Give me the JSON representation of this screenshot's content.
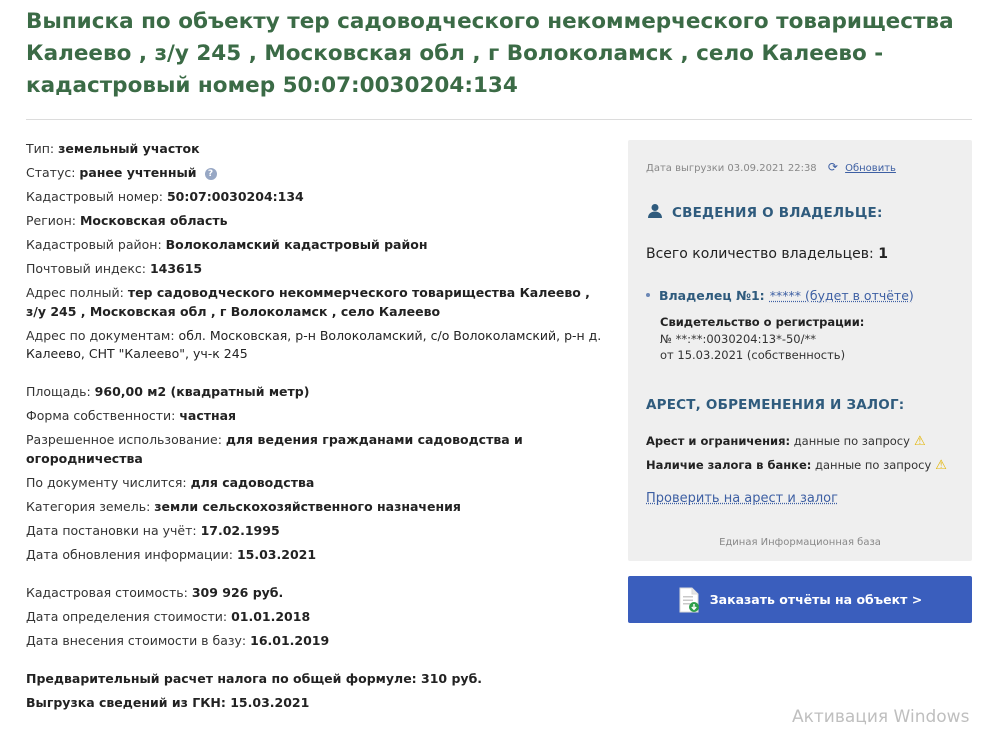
{
  "title": "Выписка по объекту тер садоводческого некоммерческого товарищества Калеево , з/у 245 , Московская обл , г Волоколамск , село Калеево - кадастровый номер 50:07:0030204:134",
  "info": {
    "type": {
      "label": "Тип: ",
      "value": "земельный участок"
    },
    "status": {
      "label": "Статус: ",
      "value": "ранее учтенный",
      "help": "?"
    },
    "cadastral_number": {
      "label": "Кадастровый номер: ",
      "value": "50:07:0030204:134"
    },
    "region": {
      "label": "Регион: ",
      "value": "Московская область"
    },
    "cadastral_district": {
      "label": "Кадастровый район: ",
      "value": "Волоколамский кадастровый район"
    },
    "postal_index": {
      "label": "Почтовый индекс: ",
      "value": "143615"
    },
    "full_address": {
      "label": "Адрес полный: ",
      "value": "тер садоводческого некоммерческого товарищества Калеево , з/у 245 , Московская обл , г Волоколамск , село Калеево"
    },
    "doc_address": {
      "label": "Адрес по документам: ",
      "value": "обл. Московская, р-н Волоколамский, с/о Волоколамский, р-н д. Калеево, СНТ \"Калеево\", уч-к 245"
    },
    "area": {
      "label": "Площадь: ",
      "value": "960,00 м2 (квадратный метр)"
    },
    "ownership_form": {
      "label": "Форма собственности: ",
      "value": "частная"
    },
    "permitted_use": {
      "label": "Разрешенное использование: ",
      "value": "для ведения гражданами садоводства и огородничества"
    },
    "by_document": {
      "label": "По документу числится: ",
      "value": "для садоводства"
    },
    "land_category": {
      "label": "Категория земель: ",
      "value": "земли сельскохозяйственного назначения"
    },
    "registration_date": {
      "label": "Дата постановки на учёт: ",
      "value": "17.02.1995"
    },
    "update_date": {
      "label": "Дата обновления информации: ",
      "value": "15.03.2021"
    },
    "cadastral_cost": {
      "label": "Кадастровая стоимость: ",
      "value": "309 926 руб."
    },
    "cost_determination_date": {
      "label": "Дата определения стоимости: ",
      "value": "01.01.2018"
    },
    "cost_entry_date": {
      "label": "Дата внесения стоимости в базу: ",
      "value": "16.01.2019"
    },
    "tax_estimate": "Предварительный расчет налога по общей формуле: 310 руб.",
    "gkn_export": "Выгрузка сведений из ГКН: 15.03.2021"
  },
  "panel": {
    "export_date": "Дата выгрузки 03.09.2021 22:38",
    "refresh_label": "Обновить",
    "owner_heading": "СВЕДЕНИЯ О ВЛАДЕЛЬЦЕ:",
    "owner_total_label": "Всего количество владельцев: ",
    "owner_total_value": "1",
    "owner_name_label": "Владелец №1:",
    "owner_link": "***** (будет в отчёте)",
    "cert_title": "Свидетельство о регистрации:",
    "cert_number": "№ **:**:0030204:13*-50/**",
    "cert_date": "от 15.03.2021 (собственность)",
    "arrest_heading": "АРЕСТ, ОБРЕМЕНЕНИЯ И ЗАЛОГ:",
    "arrest_label": "Арест и ограничения:",
    "arrest_value": " данные по запросу",
    "pledge_label": "Наличие залога в банке:",
    "pledge_value": " данные по запросу",
    "check_link": "Проверить на арест и залог",
    "db_name": "Единая Информационная база"
  },
  "order_button": "Заказать отчёты на объект >",
  "watermark": "Активация Windows",
  "colors": {
    "title": "#3b6b46",
    "accent_blue": "#3a5ebd",
    "heading_blue": "#2f5b7d",
    "warning": "#e3b400"
  }
}
